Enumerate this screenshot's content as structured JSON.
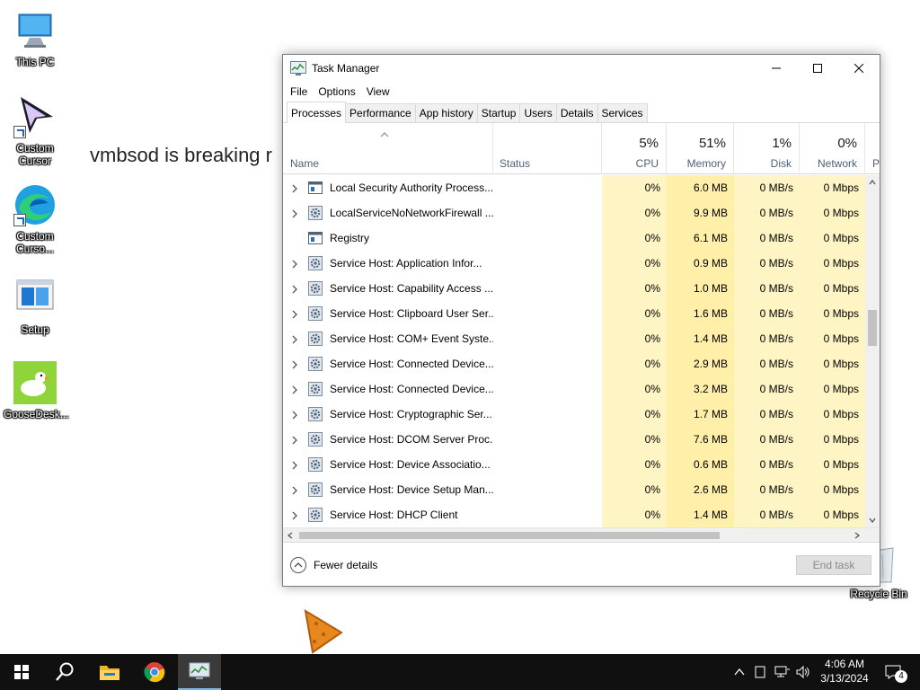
{
  "desktop": {
    "icons": [
      {
        "label": "This PC"
      },
      {
        "label": "Custom\nCursor"
      },
      {
        "label": "Custom\nCurso..."
      },
      {
        "label": "Setup"
      },
      {
        "label": "GooseDesk..."
      }
    ],
    "background_text": "vmbsod is breaking r",
    "recycle_bin": "Recycle Bin"
  },
  "window": {
    "title": "Task Manager",
    "menu": [
      "File",
      "Options",
      "View"
    ],
    "tabs": [
      "Processes",
      "Performance",
      "App history",
      "Startup",
      "Users",
      "Details",
      "Services"
    ],
    "active_tab": "Processes",
    "columns": {
      "name": "Name",
      "status": "Status",
      "cpu": {
        "pct": "5%",
        "label": "CPU"
      },
      "memory": {
        "pct": "51%",
        "label": "Memory"
      },
      "disk": {
        "pct": "1%",
        "label": "Disk"
      },
      "network": {
        "pct": "0%",
        "label": "Network"
      },
      "power": "P"
    },
    "processes": [
      {
        "name": "Local Security Authority Process...",
        "cpu": "0%",
        "memory": "6.0 MB",
        "disk": "0 MB/s",
        "network": "0 Mbps",
        "expandable": true,
        "icon": "window-icon"
      },
      {
        "name": "LocalServiceNoNetworkFirewall ...",
        "cpu": "0%",
        "memory": "9.9 MB",
        "disk": "0 MB/s",
        "network": "0 Mbps",
        "expandable": true,
        "icon": "gear-icon"
      },
      {
        "name": "Registry",
        "cpu": "0%",
        "memory": "6.1 MB",
        "disk": "0 MB/s",
        "network": "0 Mbps",
        "expandable": false,
        "icon": "window-icon"
      },
      {
        "name": "Service Host: Application Infor...",
        "cpu": "0%",
        "memory": "0.9 MB",
        "disk": "0 MB/s",
        "network": "0 Mbps",
        "expandable": true,
        "icon": "gear-icon"
      },
      {
        "name": "Service Host: Capability Access ...",
        "cpu": "0%",
        "memory": "1.0 MB",
        "disk": "0 MB/s",
        "network": "0 Mbps",
        "expandable": true,
        "icon": "gear-icon"
      },
      {
        "name": "Service Host: Clipboard User Ser...",
        "cpu": "0%",
        "memory": "1.6 MB",
        "disk": "0 MB/s",
        "network": "0 Mbps",
        "expandable": true,
        "icon": "gear-icon"
      },
      {
        "name": "Service Host: COM+ Event Syste...",
        "cpu": "0%",
        "memory": "1.4 MB",
        "disk": "0 MB/s",
        "network": "0 Mbps",
        "expandable": true,
        "icon": "gear-icon"
      },
      {
        "name": "Service Host: Connected Device...",
        "cpu": "0%",
        "memory": "2.9 MB",
        "disk": "0 MB/s",
        "network": "0 Mbps",
        "expandable": true,
        "icon": "gear-icon"
      },
      {
        "name": "Service Host: Connected Device...",
        "cpu": "0%",
        "memory": "3.2 MB",
        "disk": "0 MB/s",
        "network": "0 Mbps",
        "expandable": true,
        "icon": "gear-icon"
      },
      {
        "name": "Service Host: Cryptographic Ser...",
        "cpu": "0%",
        "memory": "1.7 MB",
        "disk": "0 MB/s",
        "network": "0 Mbps",
        "expandable": true,
        "icon": "gear-icon"
      },
      {
        "name": "Service Host: DCOM Server Proc...",
        "cpu": "0%",
        "memory": "7.6 MB",
        "disk": "0 MB/s",
        "network": "0 Mbps",
        "expandable": true,
        "icon": "gear-icon"
      },
      {
        "name": "Service Host: Device Associatio...",
        "cpu": "0%",
        "memory": "0.6 MB",
        "disk": "0 MB/s",
        "network": "0 Mbps",
        "expandable": true,
        "icon": "gear-icon"
      },
      {
        "name": "Service Host: Device Setup Man...",
        "cpu": "0%",
        "memory": "2.6 MB",
        "disk": "0 MB/s",
        "network": "0 Mbps",
        "expandable": true,
        "icon": "gear-icon"
      },
      {
        "name": "Service Host: DHCP Client",
        "cpu": "0%",
        "memory": "1.4 MB",
        "disk": "0 MB/s",
        "network": "0 Mbps",
        "expandable": true,
        "icon": "gear-icon"
      }
    ],
    "footer": {
      "fewer_details": "Fewer details",
      "end_task": "End task"
    }
  },
  "taskbar": {
    "time": "4:06 AM",
    "date": "3/13/2024",
    "notification_count": "4",
    "accent": "#7ab4ea"
  }
}
